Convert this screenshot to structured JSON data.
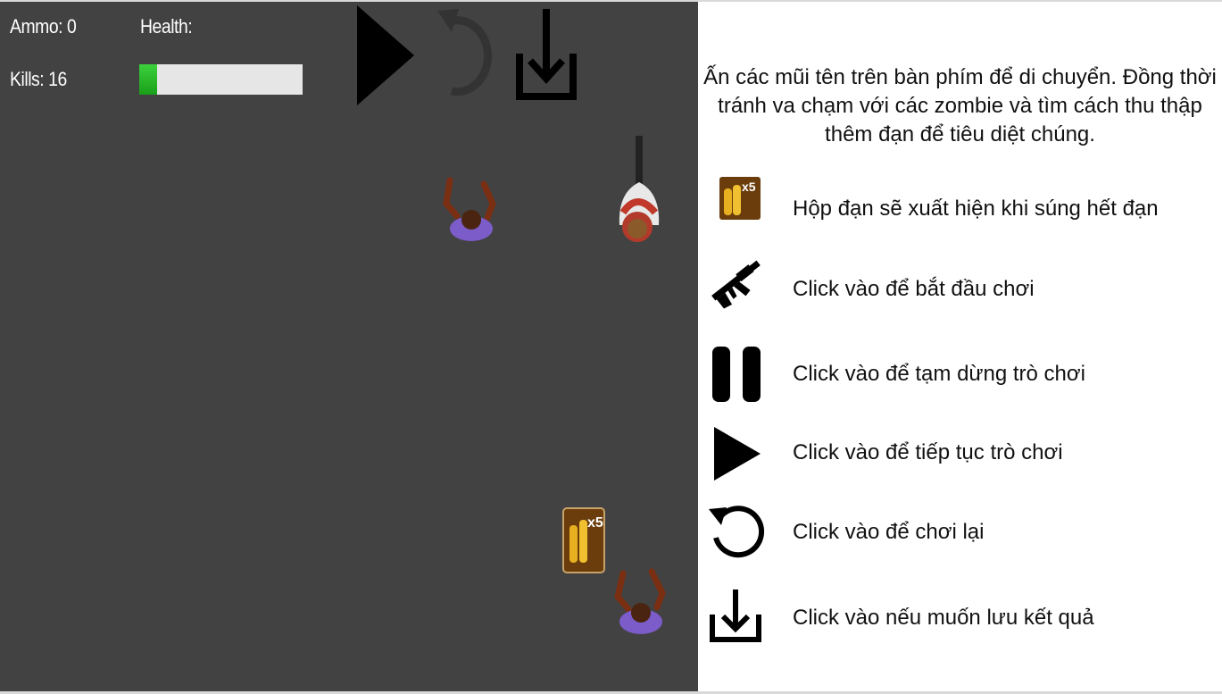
{
  "hud": {
    "ammo_label": "Ammo: 0",
    "kills_label": "Kills: 16",
    "health_label": "Health:",
    "health_value": 0.11
  },
  "controls": [
    "play-icon",
    "restart-icon",
    "download-icon"
  ],
  "colors": {
    "game_background": "#424242",
    "health_fill": "#2db82d",
    "health_track": "#e6e6e6",
    "ammo_box": "#6b3d0c",
    "bullet": "#e8b020"
  },
  "ammo_box": {
    "badge": "x5"
  },
  "instructions": {
    "intro": "Ấn các mũi tên trên bàn phím để di chuyển. Đồng thời tránh va chạm với các zombie và tìm cách thu thập thêm đạn để tiêu diệt chúng.",
    "items": [
      {
        "icon": "ammo-box-icon",
        "text": "Hộp đạn sẽ xuất hiện khi súng hết đạn"
      },
      {
        "icon": "rifle-icon",
        "text": "Click vào để bắt đầu chơi"
      },
      {
        "icon": "pause-icon",
        "text": "Click vào để tạm dừng trò chơi"
      },
      {
        "icon": "play-icon",
        "text": "Click vào để tiếp tục trò chơi"
      },
      {
        "icon": "restart-icon",
        "text": "Click vào để chơi lại"
      },
      {
        "icon": "download-icon",
        "text": "Click vào nếu muốn lưu kết quả"
      }
    ]
  }
}
